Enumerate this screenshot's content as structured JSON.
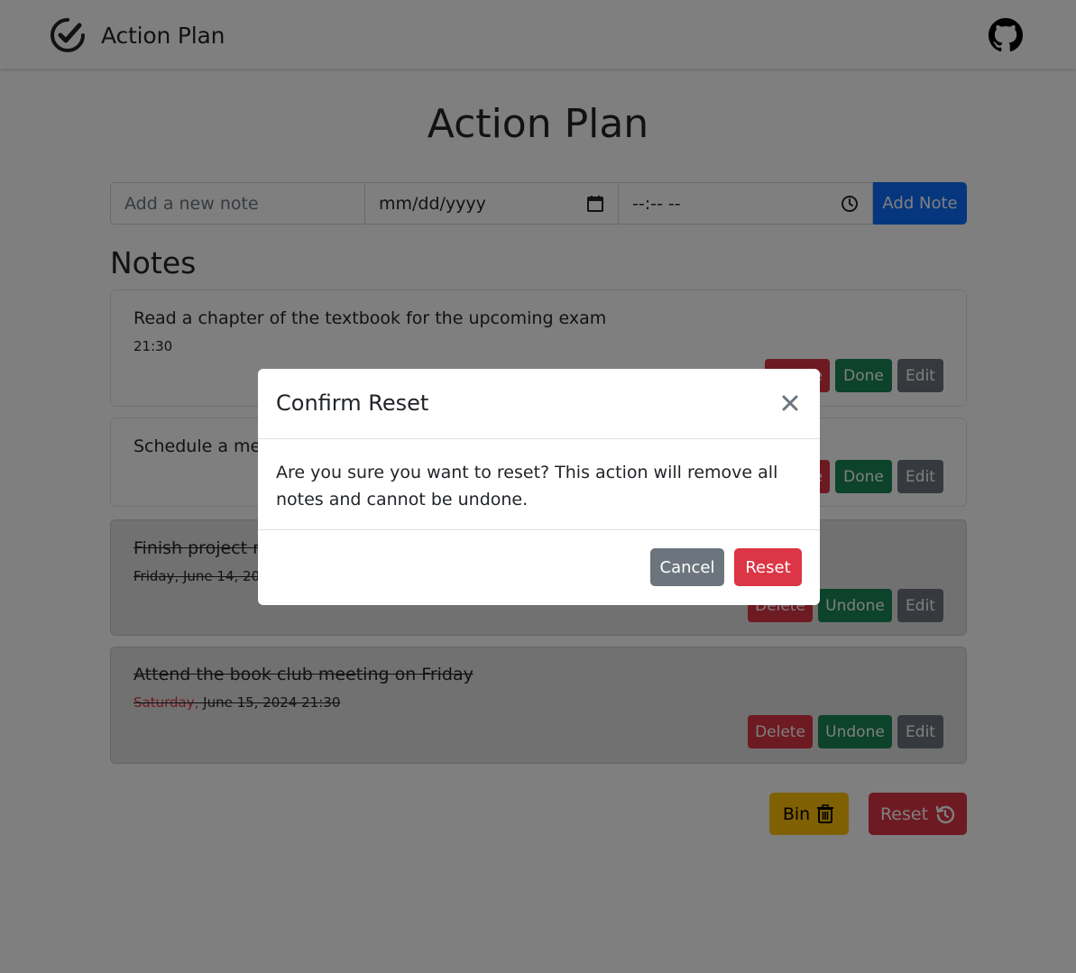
{
  "navbar": {
    "brand_text": "Action Plan",
    "brand_icon": "check-circle-icon",
    "github_icon": "github-icon"
  },
  "page": {
    "title": "Action Plan"
  },
  "add_form": {
    "note_placeholder": "Add a new note",
    "date_placeholder": "mm/dd/yyyy",
    "time_placeholder": "--:-- --",
    "add_button": "Add Note"
  },
  "notes_section": {
    "title": "Notes"
  },
  "notes": [
    {
      "text": "Read a chapter of the textbook for the upcoming exam",
      "meta": "21:30",
      "done": false,
      "buttons": [
        "Delete",
        "Done",
        "Edit"
      ]
    },
    {
      "text": "Schedule a mee",
      "meta": "",
      "done": false,
      "buttons": [
        "Delete",
        "Done",
        "Edit"
      ]
    },
    {
      "text": "Finish project re",
      "meta": "Friday, June 14, 20",
      "done": true,
      "buttons": [
        "Delete",
        "Undone",
        "Edit"
      ]
    },
    {
      "text": "Attend the book club meeting on Friday",
      "meta_day": "Saturday,",
      "meta_rest": " June 15, 2024 21:30",
      "done": true,
      "buttons": [
        "Delete",
        "Undone",
        "Edit"
      ]
    }
  ],
  "footer_buttons": {
    "bin_label": "Bin",
    "bin_icon": "trash-icon",
    "reset_label": "Reset",
    "reset_icon": "history-icon"
  },
  "modal": {
    "title": "Confirm Reset",
    "body": "Are you sure you want to reset? This action will remove all notes and cannot be undone.",
    "cancel_label": "Cancel",
    "reset_label": "Reset"
  },
  "colors": {
    "primary": "#0d6efd",
    "danger": "#dc3545",
    "success": "#198754",
    "secondary": "#6c757d",
    "warning": "#ffc107"
  }
}
